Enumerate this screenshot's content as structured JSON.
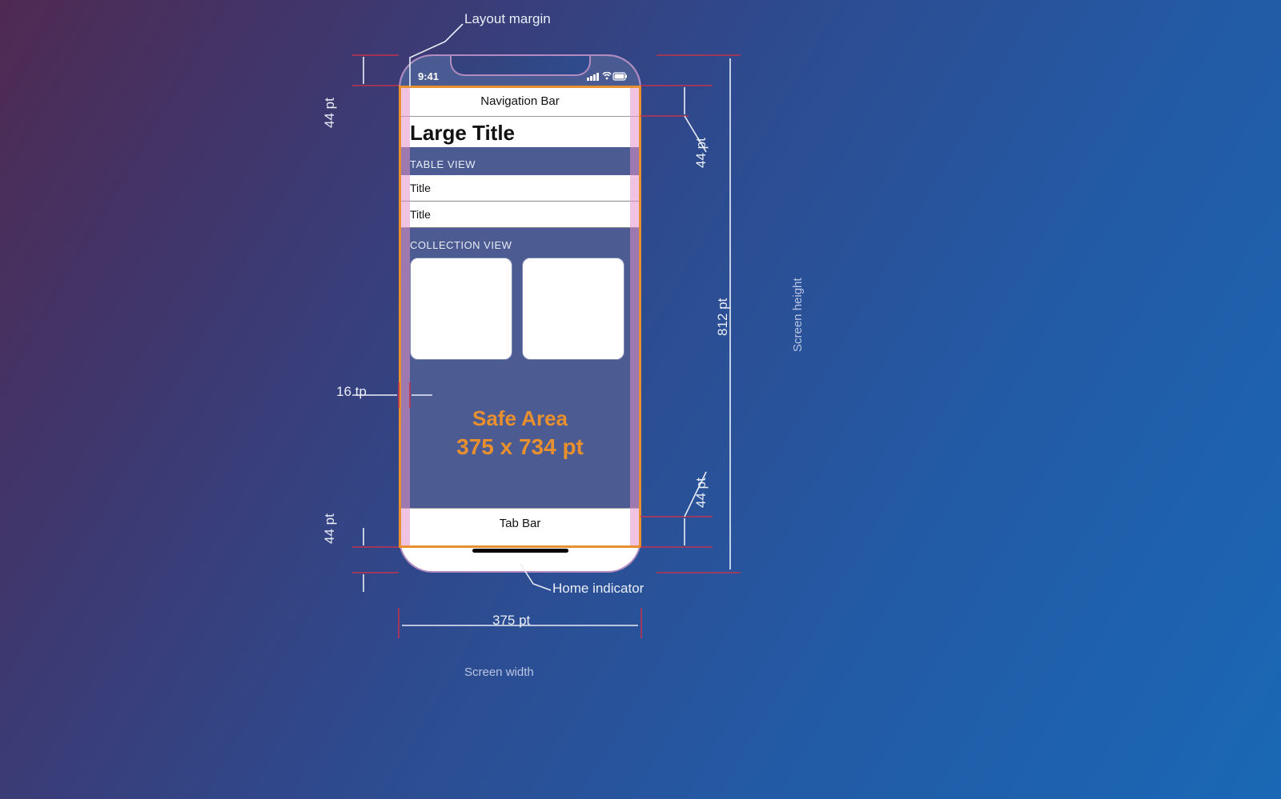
{
  "labels": {
    "layout_margin": "Layout margin",
    "screen_height": "Screen height",
    "screen_width": "Screen width",
    "home_indicator": "Home indicator"
  },
  "dims": {
    "status_44": "44 pt",
    "nav_44": "44 pt",
    "tab_44_r": "44 pt",
    "tab_44_l": "44 pt",
    "margin_16": "16 tp",
    "height_812": "812 pt",
    "width_375": "375 pt"
  },
  "phone": {
    "time": "9:41",
    "nav_bar": "Navigation Bar",
    "large_title": "Large Title",
    "table_header": "TABLE VIEW",
    "tv_row1": "Title",
    "tv_row2": "Title",
    "collection_header": "COLLECTION VIEW",
    "safe_line1": "Safe Area",
    "safe_line2": "375 x 734 pt",
    "tab_bar": "Tab Bar"
  },
  "chart_data": {
    "type": "diagram",
    "title": "iPhone X layout dimensions",
    "screen": {
      "width_pt": 375,
      "height_pt": 812
    },
    "safe_area": {
      "width_pt": 375,
      "height_pt": 734
    },
    "status_bar_pt": 44,
    "navigation_bar_pt": 44,
    "tab_bar_pt": 44,
    "home_indicator_pt": 44,
    "layout_margin_pt": 16,
    "regions": [
      "Navigation Bar",
      "Large Title",
      "TABLE VIEW",
      "COLLECTION VIEW",
      "Safe Area",
      "Tab Bar",
      "Home indicator"
    ]
  }
}
